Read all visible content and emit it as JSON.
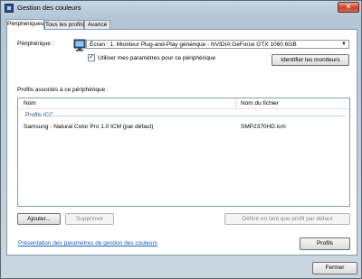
{
  "window": {
    "title": "Gestion des couleurs",
    "close_label": "✕"
  },
  "tabs": [
    {
      "label": "Périphériques"
    },
    {
      "label": "Tous les profils"
    },
    {
      "label": "Avancé"
    }
  ],
  "device": {
    "label": "Périphérique :",
    "selected": "Écran : 1. Moniteur Plug-and-Play générique - NVIDIA GeForce GTX 1060 6GB",
    "use_settings_label": "Utiliser mes paramètres pour ce périphérique",
    "use_settings_checked": true,
    "identify_label": "Identifier les moniteurs"
  },
  "profiles": {
    "section_label": "Profils associés à ce périphérique :",
    "columns": [
      "Nom",
      "Nom du fichier"
    ],
    "group": "Profils ICC",
    "rows": [
      {
        "name": "Samsung - Natural Color Pro 1.0 ICM (par défaut)",
        "file": "SMP2370HD.icm"
      }
    ]
  },
  "actions": {
    "add": "Ajouter...",
    "remove": "Supprimer",
    "set_default": "Définir en tant que profil par défaut"
  },
  "footer": {
    "link": "Présentation des paramètres de gestion des couleurs",
    "profiles_button": "Profils",
    "close_button": "Fermer"
  }
}
